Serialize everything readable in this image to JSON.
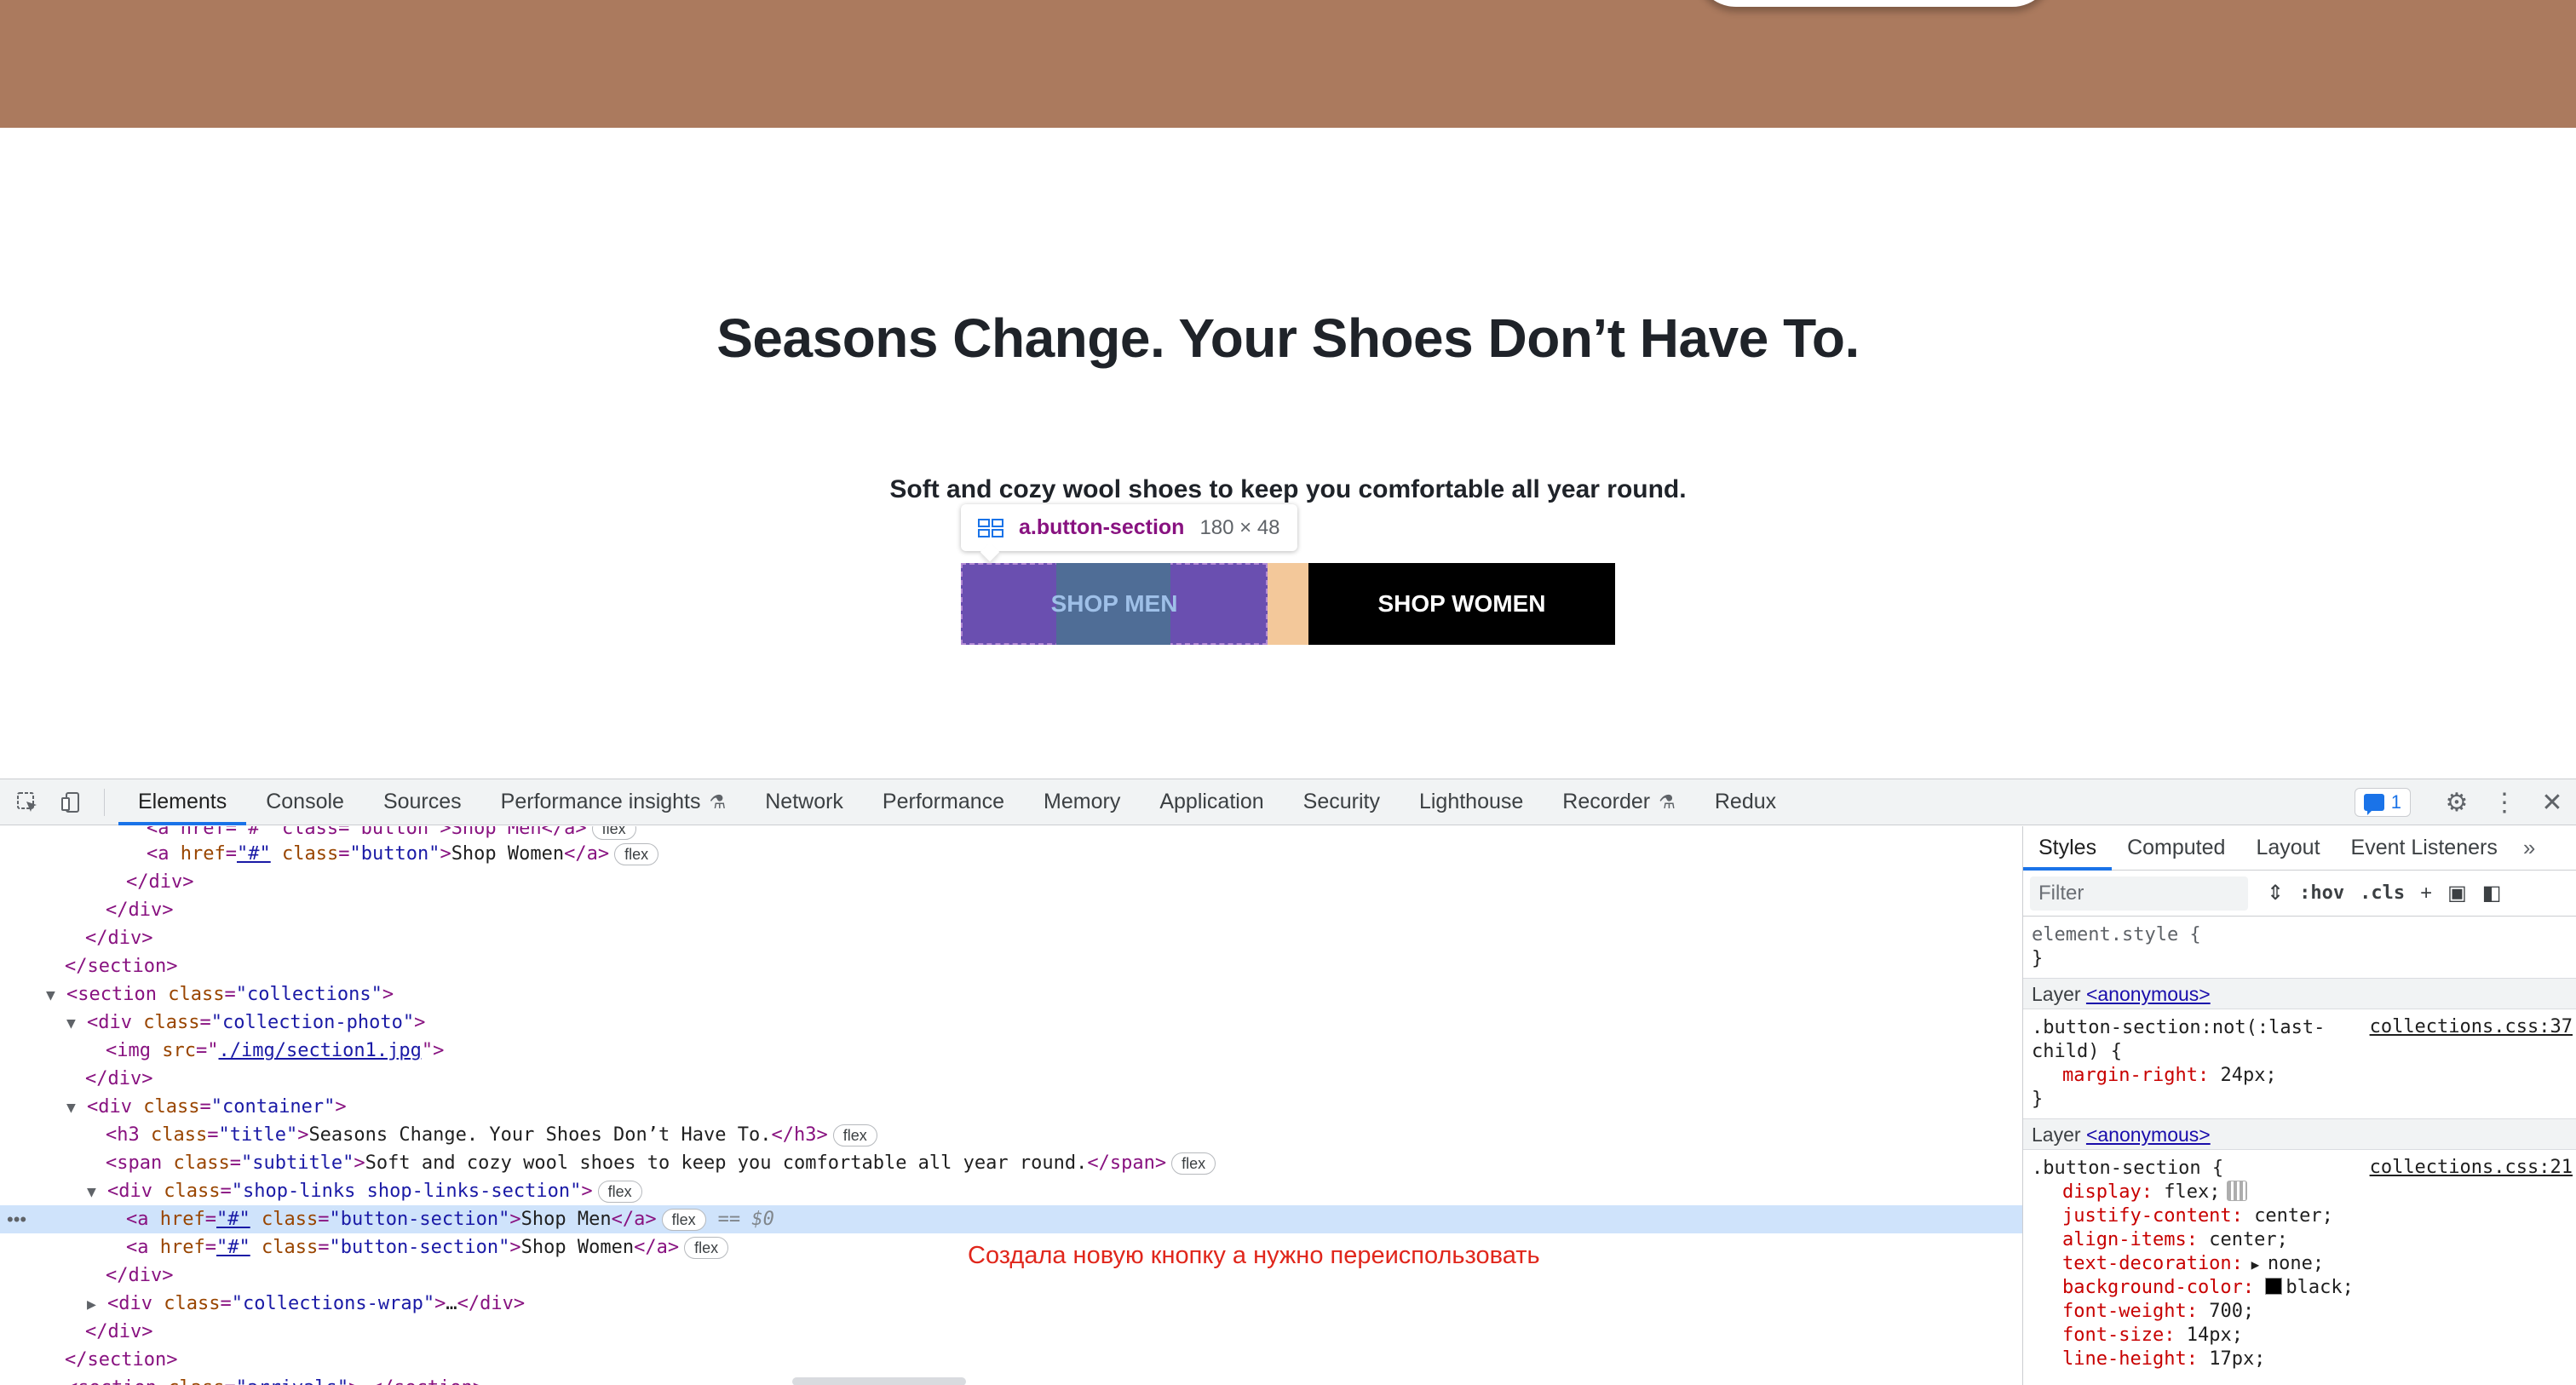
{
  "site": {
    "title": "Seasons Change. Your Shoes Don’t Have To.",
    "subtitle": "Soft and cozy wool shoes to keep you comfortable all year round.",
    "tooltip": {
      "selector": "a.button-section",
      "size": "180 × 48"
    },
    "btn_men": "SHOP MEN",
    "btn_women": "SHOP WOMEN",
    "colors": {
      "banner": "#ab7a5e",
      "highlight": "#6a4fb0",
      "margin": "#f3c89a"
    }
  },
  "devtools": {
    "tabs": [
      "Elements",
      "Console",
      "Sources",
      "Performance insights",
      "Network",
      "Performance",
      "Memory",
      "Application",
      "Security",
      "Lighthouse",
      "Recorder",
      "Redux"
    ],
    "active_tab": "Elements",
    "issues_count": "1",
    "dom": {
      "l0": {
        "text": "<a href=\"#\" class=\"button\">Shop Men</a>",
        "badge": "flex"
      },
      "l1_href": "\"#\"",
      "l1_class": "\"button\"",
      "l1_text": "Shop Women",
      "l1_badge": "flex",
      "l2": "</div>",
      "l3": "</div>",
      "l4": "</div>",
      "l5": "</section>",
      "l6_tag": "<section ",
      "l6_attr": "class",
      "l6_val": "\"collections\"",
      "l7_tag": "<div ",
      "l7_attr": "class",
      "l7_val": "\"collection-photo\"",
      "l8_tag": "<img ",
      "l8_attr": "src",
      "l8_val": "./img/section1.jpg",
      "l9": "</div>",
      "l10_tag": "<div ",
      "l10_attr": "class",
      "l10_val": "\"container\"",
      "l11_tag": "<h3 ",
      "l11_attr": "class",
      "l11_val": "\"title\"",
      "l11_text": "Seasons Change. Your Shoes Don’t Have To.",
      "l11_close": "</h3>",
      "l11_badge": "flex",
      "l12_tag": "<span ",
      "l12_attr": "class",
      "l12_val": "\"subtitle\"",
      "l12_text": "Soft and cozy wool shoes to keep you comfortable all year round.",
      "l12_close": "</span>",
      "l12_badge": "flex",
      "l13_tag": "<div ",
      "l13_attr": "class",
      "l13_val": "\"shop-links shop-links-section\"",
      "l13_badge": "flex",
      "l14_href": "\"#\"",
      "l14_class": "\"button-section\"",
      "l14_text": "Shop Men",
      "l14_badge": "flex",
      "l14_dollar": "== $0",
      "l15_href": "\"#\"",
      "l15_class": "\"button-section\"",
      "l15_text": "Shop Women",
      "l15_badge": "flex",
      "l16": "</div>",
      "l17_tag": "<div ",
      "l17_attr": "class",
      "l17_val": "\"collections-wrap\"",
      "l17_text": "…",
      "l17_close": "</div>",
      "l18": "</div>",
      "l19": "</section>",
      "l20_tag": "<section ",
      "l20_attr": "class",
      "l20_val": "\"arrivals\"",
      "l20_text": "…",
      "l20_close": "</section>"
    },
    "annotation": "Создала новую кнопку а нужно переиспользовать",
    "styles": {
      "tabs": [
        "Styles",
        "Computed",
        "Layout",
        "Event Listeners"
      ],
      "filter_placeholder": "Filter",
      "hov": ":hov",
      "cls": ".cls",
      "element_style": "element.style {",
      "close_brace": "}",
      "layer_label": "Layer",
      "layer_link": "<anonymous>",
      "rule1_selector": ".button-section:not(:last-",
      "rule1_selector2": "child) {",
      "rule1_source": "collections.css:37",
      "rule1_prop": "margin-right",
      "rule1_val": "24px;",
      "rule2_selector": ".button-section {",
      "rule2_source": "collections.css:21",
      "rule2_props": [
        {
          "name": "display",
          "value": "flex;"
        },
        {
          "name": "justify-content",
          "value": "center;"
        },
        {
          "name": "align-items",
          "value": "center;"
        },
        {
          "name": "text-decoration",
          "value": "none;"
        },
        {
          "name": "background-color",
          "value": "black;"
        },
        {
          "name": "font-weight",
          "value": "700;"
        },
        {
          "name": "font-size",
          "value": "14px;"
        },
        {
          "name": "line-height",
          "value": "17px;"
        }
      ]
    }
  }
}
